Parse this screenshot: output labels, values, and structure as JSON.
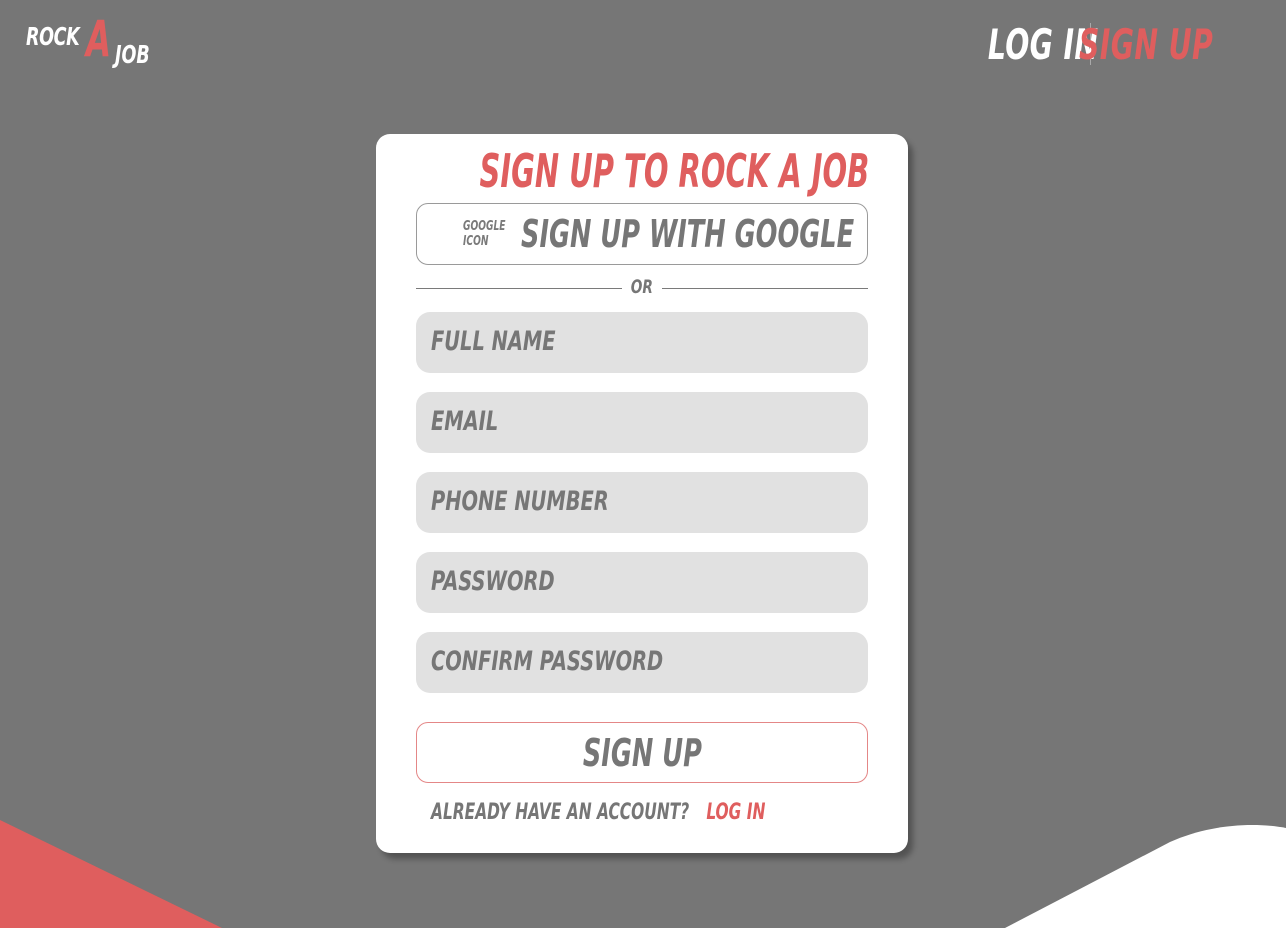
{
  "logo": {
    "part1": "ROCK",
    "part2": "A",
    "part3": "JOB"
  },
  "nav": {
    "login": "LOG IN",
    "signup": "SIGN UP"
  },
  "form": {
    "title": "SIGN UP TO ROCK A JOB",
    "google_icon_label": "GOOGLE ICON",
    "google_button": "SIGN UP WITH GOOGLE",
    "divider": "OR",
    "fields": {
      "full_name": "FULL NAME",
      "email": "EMAIL",
      "phone": "PHONE NUMBER",
      "password": "PASSWORD",
      "confirm_password": "CONFIRM PASSWORD"
    },
    "submit": "SIGN UP",
    "footer_text": "ALREADY HAVE AN ACCOUNT?",
    "footer_link": "LOG IN"
  },
  "colors": {
    "background": "#767676",
    "accent": "#df5e5e",
    "field_bg": "#e1e1e1",
    "card": "#ffffff"
  }
}
